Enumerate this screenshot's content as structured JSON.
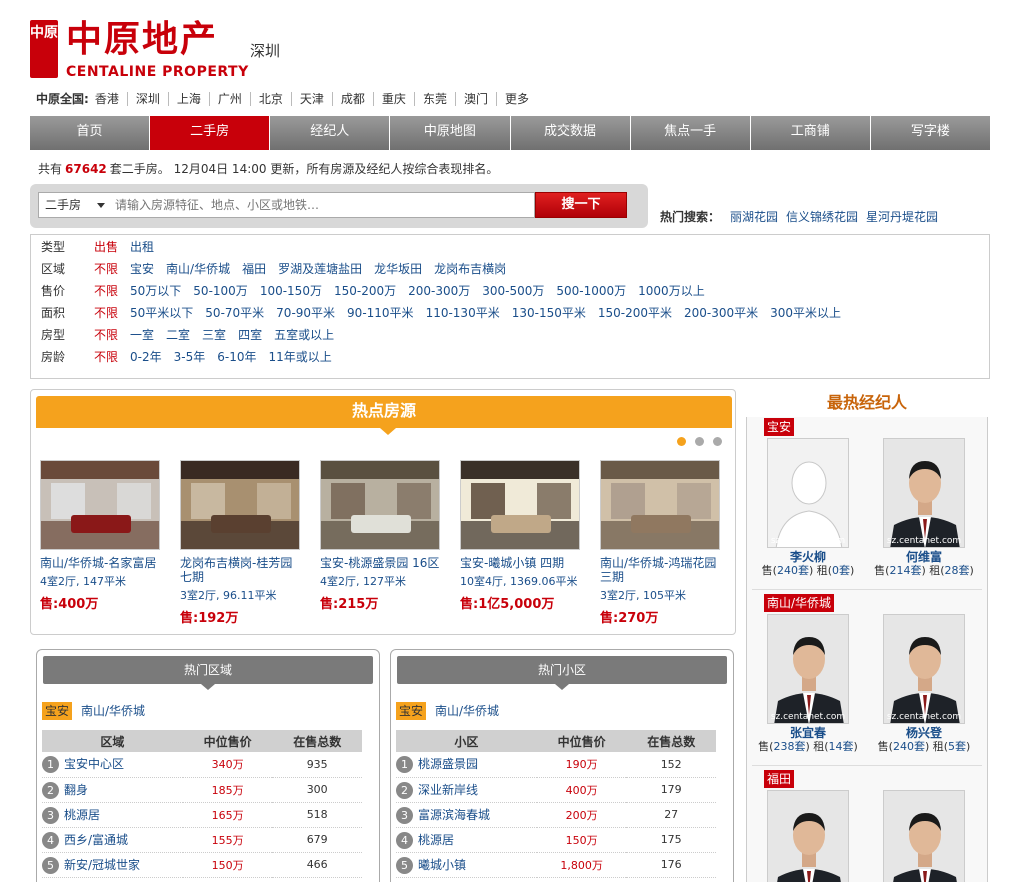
{
  "header": {
    "logo_mark": "中原",
    "logo_cn": "中原地产",
    "logo_en": "CENTALINE PROPERTY",
    "city": "深圳",
    "nation_label": "中原全国:",
    "cities": [
      "香港",
      "深圳",
      "上海",
      "广州",
      "北京",
      "天津",
      "成都",
      "重庆",
      "东莞",
      "澳门",
      "更多"
    ]
  },
  "nav": [
    "首页",
    "二手房",
    "经纪人",
    "中原地图",
    "成交数据",
    "焦点一手",
    "工商铺",
    "写字楼"
  ],
  "nav_active": 1,
  "summary": {
    "prefix": "共有",
    "count": "67642",
    "suffix": "套二手房。 12月04日 14:00 更新，所有房源及经纪人按综合表现排名。"
  },
  "search": {
    "type": "二手房",
    "placeholder": "请输入房源特征、地点、小区或地铁…",
    "button": "搜一下",
    "hot_label": "热门搜索：",
    "hot_items": [
      "丽湖花园",
      "信义锦绣花园",
      "星河丹堤花园"
    ]
  },
  "filters": [
    {
      "label": "类型",
      "options": [
        "出售",
        "出租"
      ]
    },
    {
      "label": "区域",
      "options": [
        "不限",
        "宝安",
        "南山/华侨城",
        "福田",
        "罗湖及莲塘盐田",
        "龙华坂田",
        "龙岗布吉横岗"
      ]
    },
    {
      "label": "售价",
      "options": [
        "不限",
        "50万以下",
        "50-100万",
        "100-150万",
        "150-200万",
        "200-300万",
        "300-500万",
        "500-1000万",
        "1000万以上"
      ]
    },
    {
      "label": "面积",
      "options": [
        "不限",
        "50平米以下",
        "50-70平米",
        "70-90平米",
        "90-110平米",
        "110-130平米",
        "130-150平米",
        "150-200平米",
        "200-300平米",
        "300平米以上"
      ]
    },
    {
      "label": "房型",
      "options": [
        "不限",
        "一室",
        "二室",
        "三室",
        "四室",
        "五室或以上"
      ]
    },
    {
      "label": "房龄",
      "options": [
        "不限",
        "0-2年",
        "3-5年",
        "6-10年",
        "11年或以上"
      ]
    }
  ],
  "hot_listings": {
    "title": "热点房源",
    "items": [
      {
        "name": "南山/华侨城-名家富居",
        "info": "4室2厅, 147平米",
        "price": "售:400万"
      },
      {
        "name": "龙岗布吉横岗-桂芳园七期",
        "info": "3室2厅, 96.11平米",
        "price": "售:192万"
      },
      {
        "name": "宝安-桃源盛景园 16区",
        "info": "4室2厅, 127平米",
        "price": "售:215万"
      },
      {
        "name": "宝安-曦城小镇 四期",
        "info": "10室4厅, 1369.06平米",
        "price": "售:1亿5,000万"
      },
      {
        "name": "南山/华侨城-鸿瑞花园三期",
        "info": "3室2厅, 105平米",
        "price": "售:270万"
      }
    ]
  },
  "hot_areas": {
    "title": "热门区域",
    "tags": [
      "宝安",
      "南山/华侨城"
    ],
    "headers": [
      "区域",
      "中位售价",
      "在售总数"
    ],
    "rows": [
      {
        "rank": "1",
        "name": "宝安中心区",
        "price": "340万",
        "count": "935"
      },
      {
        "rank": "2",
        "name": "翻身",
        "price": "185万",
        "count": "300"
      },
      {
        "rank": "3",
        "name": "桃源居",
        "price": "165万",
        "count": "518"
      },
      {
        "rank": "4",
        "name": "西乡/富通城",
        "price": "155万",
        "count": "679"
      },
      {
        "rank": "5",
        "name": "新安/冠城世家",
        "price": "150万",
        "count": "466"
      }
    ]
  },
  "hot_communities": {
    "title": "热门小区",
    "tags": [
      "宝安",
      "南山/华侨城"
    ],
    "headers": [
      "小区",
      "中位售价",
      "在售总数"
    ],
    "rows": [
      {
        "rank": "1",
        "name": "桃源盛景园",
        "price": "190万",
        "count": "152"
      },
      {
        "rank": "2",
        "name": "深业新岸线",
        "price": "400万",
        "count": "179"
      },
      {
        "rank": "3",
        "name": "富源滨海春城",
        "price": "200万",
        "count": "27"
      },
      {
        "rank": "4",
        "name": "桃源居",
        "price": "150万",
        "count": "175"
      },
      {
        "rank": "5",
        "name": "曦城小镇",
        "price": "1,800万",
        "count": "176"
      }
    ]
  },
  "agents": {
    "title": "最热经纪人",
    "watermark": "sz.centanet.com",
    "groups": [
      {
        "area": "宝安",
        "people": [
          {
            "name": "李火柳",
            "sale_label": "售",
            "sale": "240套",
            "rent_label": "租",
            "rent": "0套",
            "photo": "placeholder"
          },
          {
            "name": "何维富",
            "sale_label": "售",
            "sale": "214套",
            "rent_label": "租",
            "rent": "28套",
            "photo": "man"
          }
        ]
      },
      {
        "area": "南山/华侨城",
        "people": [
          {
            "name": "张宜春",
            "sale_label": "售",
            "sale": "238套",
            "rent_label": "租",
            "rent": "14套",
            "photo": "man"
          },
          {
            "name": "杨兴登",
            "sale_label": "售",
            "sale": "240套",
            "rent_label": "租",
            "rent": "5套",
            "photo": "man"
          }
        ]
      },
      {
        "area": "福田",
        "people": [
          {
            "name": "",
            "sale_label": "",
            "sale": "",
            "rent_label": "",
            "rent": "",
            "photo": "man"
          },
          {
            "name": "",
            "sale_label": "",
            "sale": "",
            "rent_label": "",
            "rent": "",
            "photo": "man"
          }
        ]
      }
    ]
  },
  "colors": {
    "brand_red": "#c8000a",
    "accent_orange": "#f5a21d",
    "link_blue": "#1a4e8a"
  }
}
